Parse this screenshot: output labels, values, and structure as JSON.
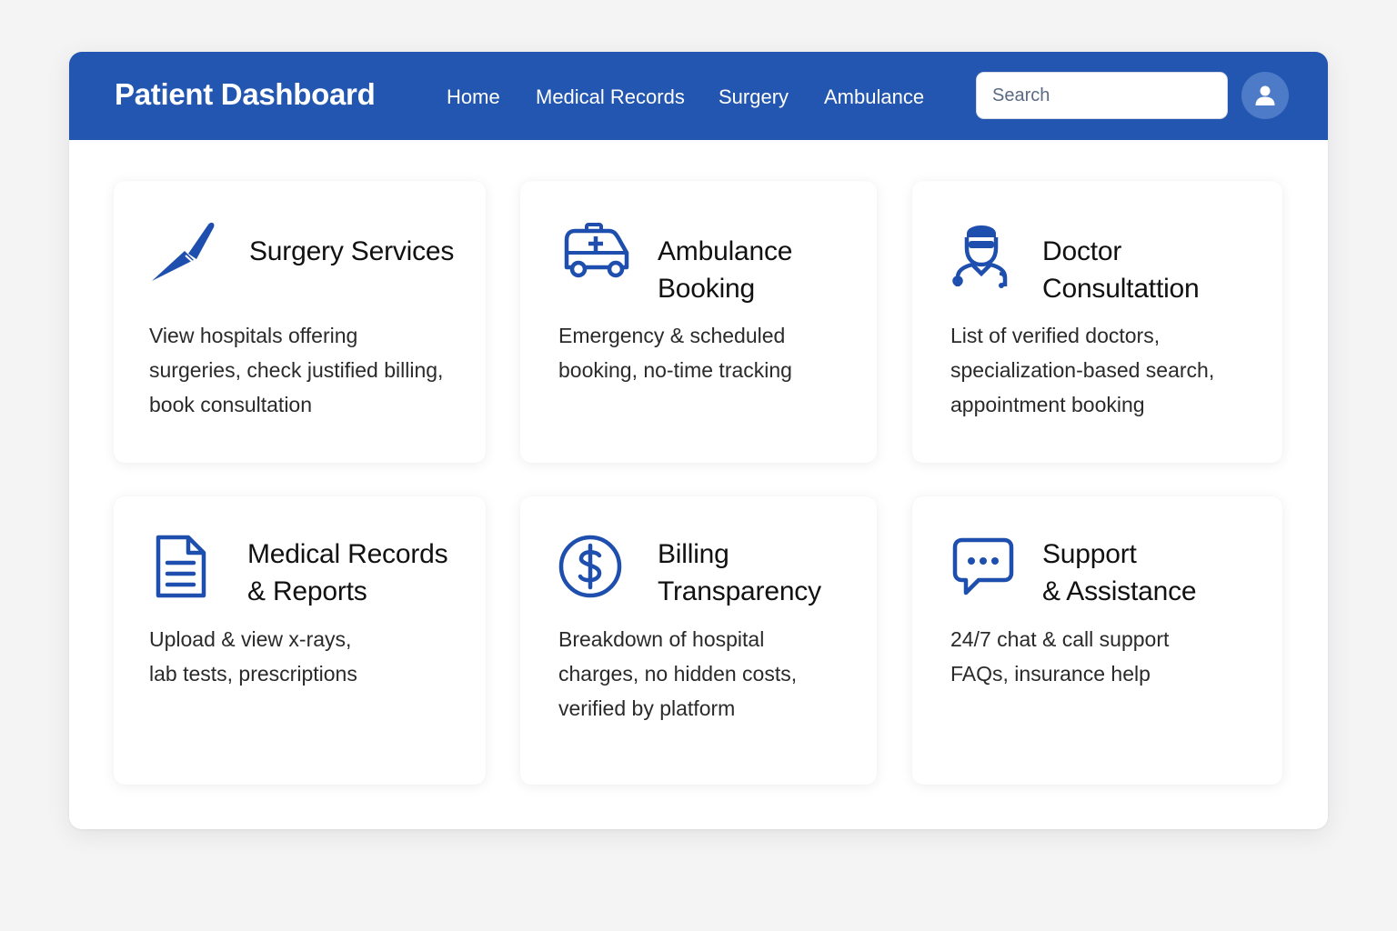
{
  "header": {
    "title": "Patient Dashboard",
    "nav": [
      "Home",
      "Medical Records",
      "Surgery",
      "Ambulance"
    ],
    "search_placeholder": "Search",
    "avatar_icon": "user-icon",
    "background": "#2356b0"
  },
  "cards": [
    {
      "icon": "scalpel-icon",
      "title_line1": "Surgery Services",
      "title_line2": "",
      "desc_line1": "View hospitals offering",
      "desc_line2": "surgeries, check justified billing,",
      "desc_line3": "book consultation"
    },
    {
      "icon": "ambulance-icon",
      "title_line1": "Ambulance",
      "title_line2": "Booking",
      "desc_line1": "Emergency & scheduled",
      "desc_line2": "booking, no-time tracking",
      "desc_line3": ""
    },
    {
      "icon": "doctor-icon",
      "title_line1": "Doctor",
      "title_line2": "Consultattion",
      "desc_line1": "List of verified doctors,",
      "desc_line2": "specialization-based search,",
      "desc_line3": "appointment booking"
    },
    {
      "icon": "document-icon",
      "title_line1": "Medical Records",
      "title_line2": "& Reports",
      "desc_line1": "Upload & view x-rays,",
      "desc_line2": "lab tests, prescriptions",
      "desc_line3": ""
    },
    {
      "icon": "dollar-icon",
      "title_line1": "Billing",
      "title_line2": "Transparency",
      "desc_line1": "Breakdown of hospital",
      "desc_line2": "charges, no hidden costs,",
      "desc_line3": "verified by platform"
    },
    {
      "icon": "chat-icon",
      "title_line1": "Support",
      "title_line2": "& Assistance",
      "desc_line1": "24/7 chat & call support",
      "desc_line2": "FAQs, insurance help",
      "desc_line3": ""
    }
  ],
  "colors": {
    "accent": "#2356b0",
    "icon": "#1e4fae"
  }
}
